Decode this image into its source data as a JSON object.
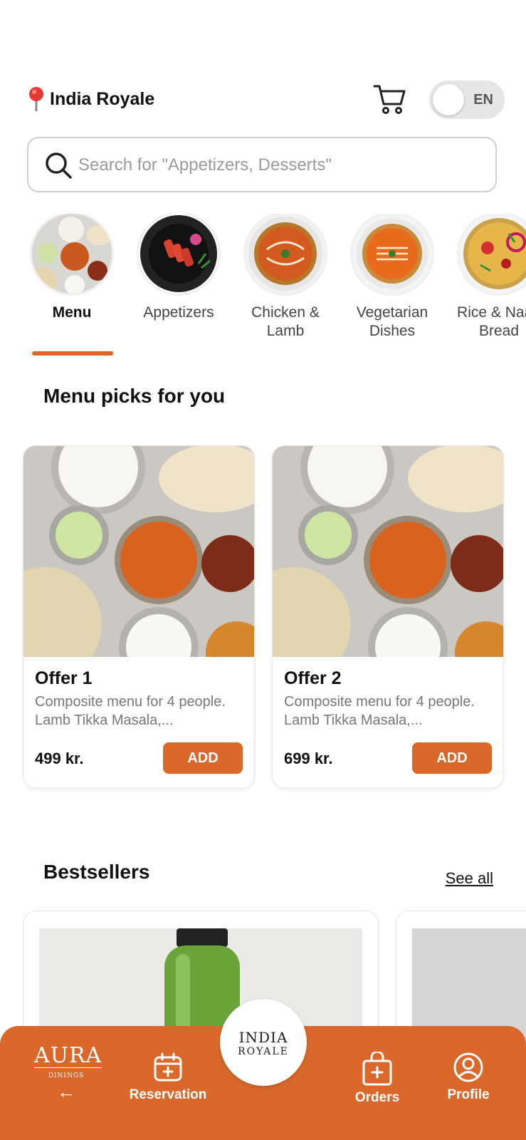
{
  "header": {
    "location_name": "India Royale",
    "language": "EN"
  },
  "search": {
    "placeholder": "Search for \"Appetizers, Desserts\""
  },
  "categories": [
    {
      "label": "Menu"
    },
    {
      "label": "Appetizers"
    },
    {
      "label": "Chicken &\nLamb"
    },
    {
      "label": "Vegetarian\nDishes"
    },
    {
      "label": "Rice & Naan\nBread"
    }
  ],
  "picks": {
    "title": "Menu picks for you",
    "offers": [
      {
        "title": "Offer 1",
        "desc": "Composite menu for 4 people. Lamb Tikka Masala,...",
        "price": "499 kr.",
        "add_label": "ADD"
      },
      {
        "title": "Offer 2",
        "desc": "Composite menu for 4 people. Lamb Tikka Masala,...",
        "price": "699 kr.",
        "add_label": "ADD"
      }
    ]
  },
  "bestsellers": {
    "title": "Bestsellers",
    "see_all": "See all"
  },
  "bottom_nav": {
    "aura_title": "AURA",
    "aura_subtitle": "DININGS",
    "back_arrow": "←",
    "reservation": "Reservation",
    "logo_line1": "INDIA",
    "logo_line2": "ROYALE",
    "orders": "Orders",
    "profile": "Profile"
  },
  "colors": {
    "accent": "#d9682a"
  }
}
